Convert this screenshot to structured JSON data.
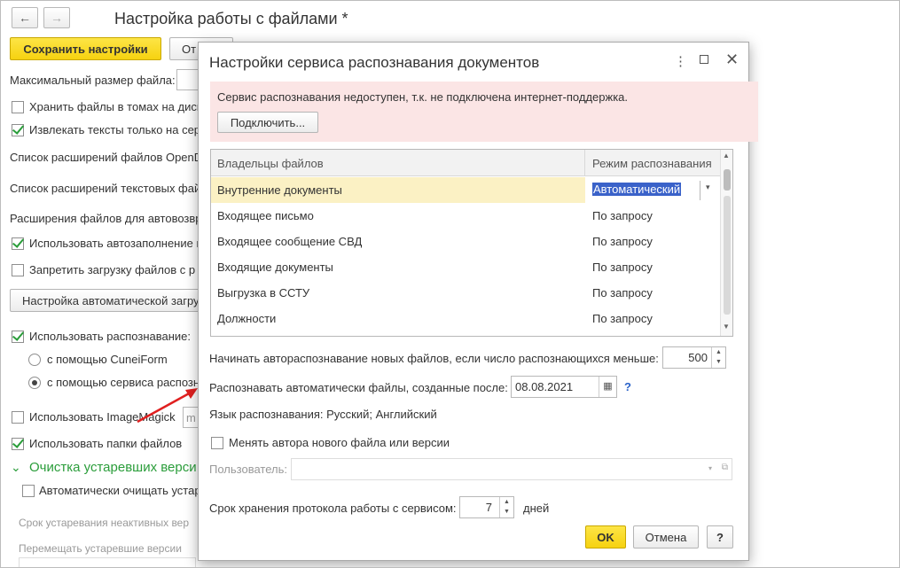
{
  "main": {
    "title": "Настройка работы с файлами *",
    "save_label": "Сохранить настройки",
    "cancel_partial": "От",
    "max_size_label": "Максимальный размер файла:",
    "store_volumes": "Хранить файлы в томах на диск",
    "extract_texts": "Извлекать тексты только на сер",
    "opendoc_list": "Список расширений файлов OpenD",
    "text_list": "Список расширений текстовых фай",
    "auto_ext": "Расширения файлов для автовозвр",
    "use_autofill": "Использовать автозаполнение ц",
    "forbid_upload": "Запретить загрузку файлов с р",
    "auto_upload_btn": "Настройка автоматической загруз",
    "use_recognition": "Использовать распознавание:",
    "cuneiform": "с помощью CuneiForm",
    "service": "с помощью сервиса распозн",
    "imagemagick": "Использовать ImageMagick",
    "imagemagick_field": "m",
    "folders": "Использовать папки файлов",
    "cleanup_section": "Очистка устаревших верси",
    "auto_clean": "Автоматически очищать устар",
    "inactive_period": "Срок устаревания неактивных вер",
    "move_old": "Перемещать устаревшие версии"
  },
  "dialog": {
    "title": "Настройки сервиса распознавания документов",
    "warning": "Сервис распознавания недоступен, т.к. не подключена интернет-поддержка.",
    "connect_label": "Подключить...",
    "col_owners": "Владельцы файлов",
    "col_mode": "Режим распознавания",
    "rows": [
      {
        "owner": "Внутренние документы",
        "mode": "Автоматический"
      },
      {
        "owner": "Входящее письмо",
        "mode": "По запросу"
      },
      {
        "owner": "Входящее сообщение СВД",
        "mode": "По запросу"
      },
      {
        "owner": "Входящие документы",
        "mode": "По запросу"
      },
      {
        "owner": "Выгрузка в ССТУ",
        "mode": "По запросу"
      },
      {
        "owner": "Должности",
        "mode": "По запросу"
      }
    ],
    "auto_start_label": "Начинать автораспознавание новых файлов, если число распознающихся меньше:",
    "auto_start_value": "500",
    "created_after_label": "Распознавать автоматически файлы, созданные после:",
    "created_after_value": "08.08.2021",
    "help_q": "?",
    "language_line": "Язык распознавания: Русский; Английский",
    "change_author": "Менять автора нового файла или версии",
    "user_label": "Пользователь:",
    "log_label": "Срок хранения протокола работы с сервисом:",
    "log_value": "7",
    "log_unit": "дней",
    "ok_label": "OK",
    "cancel_label": "Отмена",
    "help_label": "?"
  },
  "colors": {
    "accent_green": "#2a9d3a",
    "save_yellow": "#f6d210",
    "warn_bg": "#fbe5e5",
    "arrow_red": "#e02020"
  }
}
